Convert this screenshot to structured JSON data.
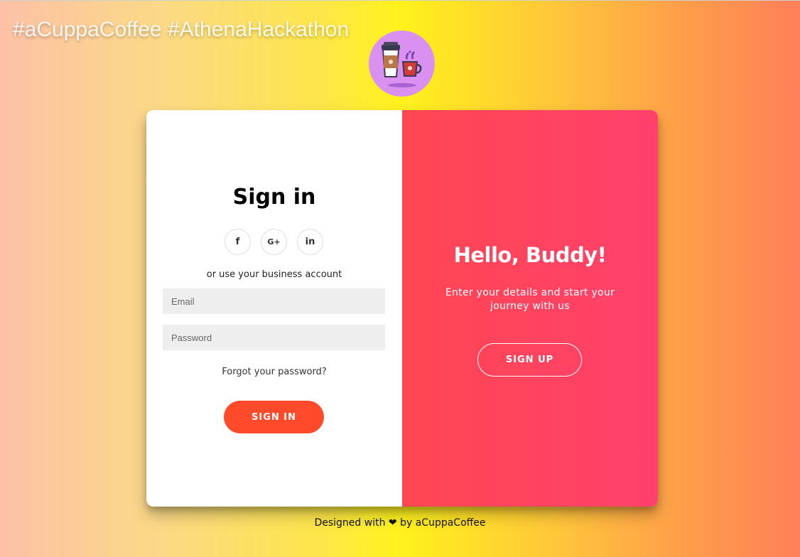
{
  "banner": {
    "hashtags": "#aCuppaCoffee #AthenaHackathon"
  },
  "logo": {
    "icon": "coffee-cups-icon",
    "background": "#d990f0"
  },
  "signin": {
    "title": "Sign in",
    "social": [
      {
        "icon": "facebook-icon",
        "label": "f"
      },
      {
        "icon": "google-plus-icon",
        "label": "G+"
      },
      {
        "icon": "linkedin-icon",
        "label": "in"
      }
    ],
    "alt_text": "or use your business account",
    "email_placeholder": "Email",
    "password_placeholder": "Password",
    "forgot": "Forgot your password?",
    "button": "SIGN IN",
    "button_color": "#ff4b2b"
  },
  "welcome": {
    "title": "Hello, Buddy!",
    "subtitle": "Enter your details and start your journey with us",
    "button": "SIGN UP",
    "panel_color": "#ff4652"
  },
  "footer": {
    "prefix": "Designed with",
    "heart": "❤",
    "suffix": "by aCuppaCoffee"
  }
}
